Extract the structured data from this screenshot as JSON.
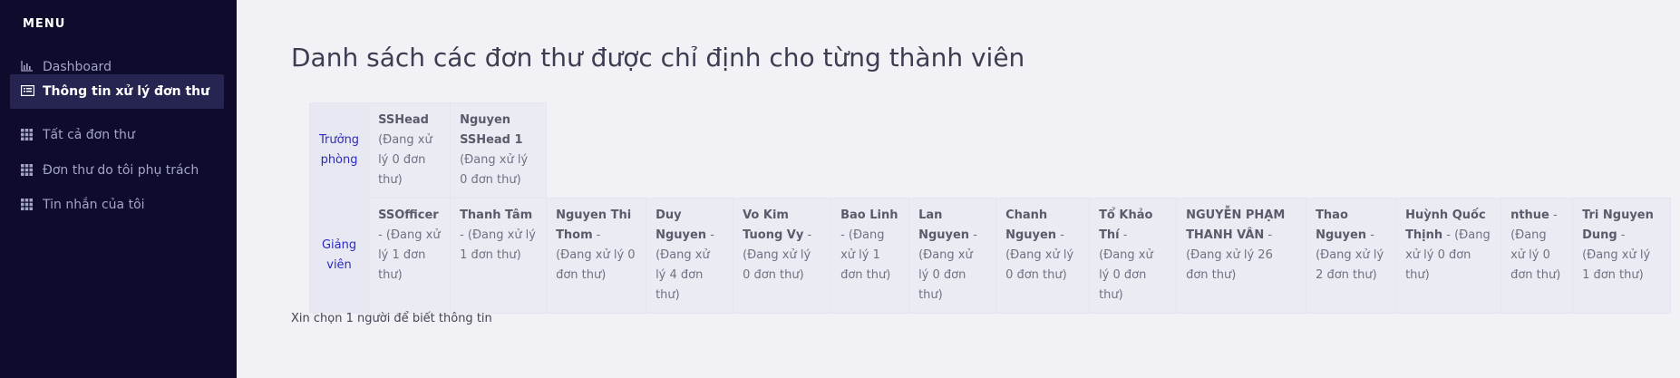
{
  "sidebar": {
    "menu_label": "MENU",
    "items": [
      {
        "label": "Dashboard",
        "icon": "chart-icon"
      },
      {
        "label": "Thông tin xử lý đơn thư",
        "icon": "list-icon"
      },
      {
        "label": "Tất cả đơn thư",
        "icon": "grid-icon"
      },
      {
        "label": "Đơn thư do tôi phụ trách",
        "icon": "grid-icon"
      },
      {
        "label": "Tin nhắn của tôi",
        "icon": "grid-icon"
      }
    ]
  },
  "main": {
    "title": "Danh sách các đơn thư được chỉ định cho từng thành viên",
    "hint": "Xin chọn 1 người để biết thông tin",
    "rows": [
      {
        "role": "Trưởng phòng",
        "members": [
          {
            "name": "SSHead",
            "status": " (Đang xử lý 0 đơn thư)"
          },
          {
            "name": "Nguyen SSHead 1",
            "status": " (Đang xử lý 0 đơn thư)"
          }
        ]
      },
      {
        "role": "Giảng viên",
        "members": [
          {
            "name": "SSOfficer",
            "status": " - (Đang xử lý 1 đơn thư)"
          },
          {
            "name": "Thanh Tâm",
            "status": " - (Đang xử lý 1 đơn thư)"
          },
          {
            "name": "Nguyen Thi Thom",
            "status": " - (Đang xử lý 0 đơn thư)"
          },
          {
            "name": "Duy Nguyen",
            "status": " - (Đang xử lý 4 đơn thư)"
          },
          {
            "name": "Vo Kim Tuong Vy",
            "status": " - (Đang xử lý 0 đơn thư)"
          },
          {
            "name": "Bao Linh",
            "status": " - (Đang xử lý 1 đơn thư)"
          },
          {
            "name": "Lan Nguyen",
            "status": " - (Đang xử lý 0 đơn thư)"
          },
          {
            "name": "Chanh Nguyen",
            "status": " - (Đang xử lý 0 đơn thư)"
          },
          {
            "name": "Tổ Khảo Thí",
            "status": " - (Đang xử lý 0 đơn thư)"
          },
          {
            "name": "NGUYỄN PHẠM THANH VÂN",
            "status": " - (Đang xử lý 26 đơn thư)"
          },
          {
            "name": "Thao Nguyen",
            "status": " - (Đang xử lý 2 đơn thư)"
          },
          {
            "name": "Huỳnh Quốc Thịnh",
            "status": " - (Đang xử lý 0 đơn thư)"
          },
          {
            "name": "nthue",
            "status": " - (Đang xử lý 0 đơn thư)"
          },
          {
            "name": "Tri Nguyen Dung",
            "status": " - (Đang xử lý 1 đơn thư)"
          }
        ]
      }
    ]
  }
}
